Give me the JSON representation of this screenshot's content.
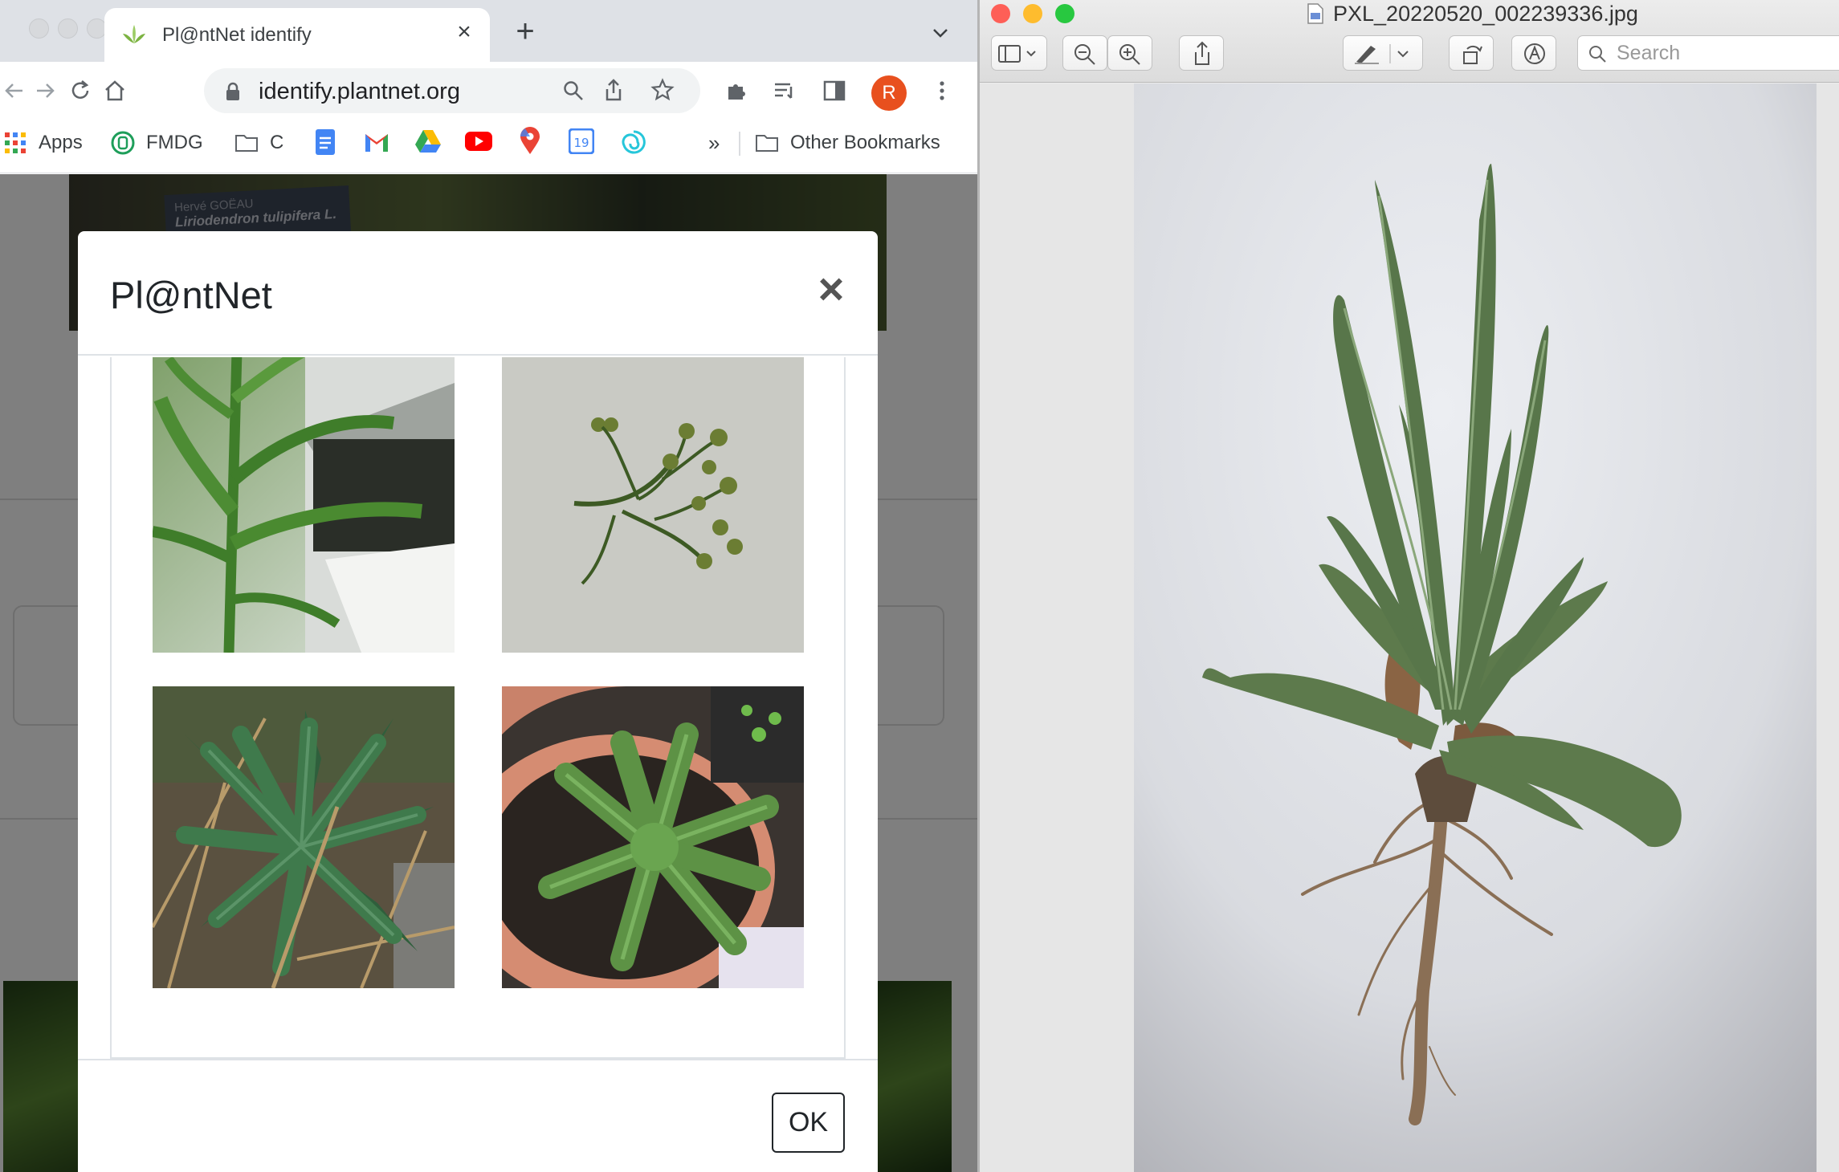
{
  "browser": {
    "tab_title": "Pl@ntNet identify",
    "tab_close": "×",
    "new_tab": "+",
    "url": "identify.plantnet.org",
    "avatar_letter": "R",
    "bookmarks": [
      "Apps",
      "FMDG",
      "C"
    ],
    "bookmarks_overflow": "»",
    "other_bookmarks": "Other Bookmarks"
  },
  "page_background": {
    "label_author": "Hervé GOËAU",
    "label_species": "Liriodendron tulipifera L."
  },
  "modal": {
    "title": "Pl@ntNet",
    "close": "×",
    "ok_label": "OK",
    "images": [
      "leafy-stem-photo",
      "flower-buds-photo",
      "rosette-ground-photo",
      "rosette-pot-photo"
    ]
  },
  "preview": {
    "title": "PXL_20220520_002239336.jpg",
    "search_placeholder": "Search",
    "image": "uprooted-plant-photo"
  },
  "colors": {
    "accent_avatar": "#e8501e",
    "close_dot": "#fe5f57",
    "minimize_dot": "#febc2e",
    "zoom_dot": "#28c840"
  }
}
